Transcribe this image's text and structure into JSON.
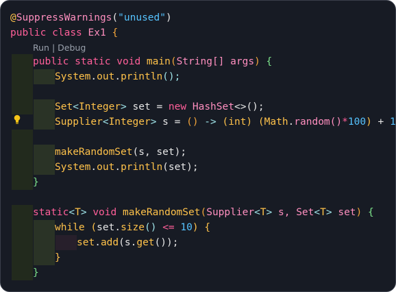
{
  "codelens": {
    "run": "Run",
    "sep": " | ",
    "debug": "Debug"
  },
  "icons": {
    "hint": "lightbulb-icon"
  },
  "code": {
    "l1": {
      "at": "@",
      "ann": "SuppressWarnings",
      "open": "(",
      "str": "\"unused\"",
      "close": ")"
    },
    "l2": {
      "pub": "public",
      "cls": "class",
      "name": "Ex1",
      "brace": "{"
    },
    "l3": {
      "pub": "public",
      "st": "static",
      "vd": "void",
      "fn": "main",
      "open": "(",
      "type": "String[]",
      "arg": "args",
      "close": ")",
      "brace": "{"
    },
    "l4": {
      "sys": "System",
      "dot1": ".",
      "out": "out",
      "dot2": ".",
      "fn": "println",
      "rest": "();"
    },
    "l6": {
      "t1": "Set",
      "g1": "<",
      "t2": "Integer",
      "g2": ">",
      "v": "set",
      "eq": "=",
      "nw": "new",
      "t3": "HashSet",
      "dia": "<>",
      "rest": "();"
    },
    "l7": {
      "t1": "Supplier",
      "g1": "<",
      "t2": "Integer",
      "g2": ">",
      "v": "s",
      "eq": "=",
      "lam": "()",
      "arrow": "->",
      "cast": "(int)",
      "p1": "(",
      "math": "Math",
      "dot": ".",
      "fn": "random",
      "call": "()",
      "mul": "*",
      "num": "100",
      "p2": ")",
      "plus": "+",
      "one": "1",
      "semi": ";"
    },
    "l9": {
      "fn": "makeRandomSet",
      "args": "(s, set);"
    },
    "l10": {
      "sys": "System",
      "dot1": ".",
      "out": "out",
      "dot2": ".",
      "fn": "println",
      "args": "(set);"
    },
    "l11": {
      "brace": "}"
    },
    "l13": {
      "st": "static",
      "g1": "<",
      "T": "T",
      "g2": ">",
      "vd": "void",
      "fn": "makeRandomSet",
      "open": "(",
      "t1": "Supplier",
      "g3": "<",
      "T2": "T",
      "g4": ">",
      "v1": "s,",
      "t2": "Set",
      "g5": "<",
      "T3": "T",
      "g6": ">",
      "v2": "set",
      "close": ")",
      "brace": "{"
    },
    "l14": {
      "kw": "while",
      "open": "(",
      "obj": "set",
      "dot": ".",
      "fn": "size",
      "call": "()",
      "op": "<=",
      "num": "10",
      "close": ")",
      "brace": "{"
    },
    "l15": {
      "obj": "set",
      "dot": ".",
      "fn": "add",
      "args": "(s.",
      "fn2": "get",
      "rest": "());"
    },
    "l16": {
      "brace": "}"
    },
    "l17": {
      "brace": "}"
    }
  }
}
